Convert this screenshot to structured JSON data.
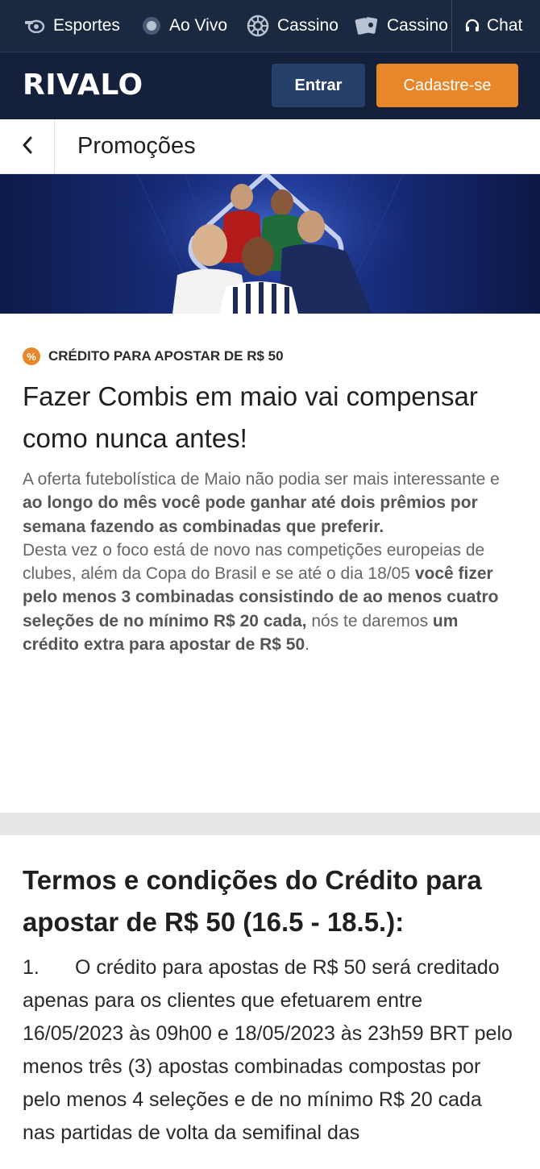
{
  "nav": {
    "items": [
      {
        "label": "Esportes",
        "icon": "whistle-icon"
      },
      {
        "label": "Ao Vivo",
        "icon": "live-dot-icon"
      },
      {
        "label": "Cassino",
        "icon": "roulette-icon"
      },
      {
        "label": "Cassino",
        "icon": "cards-icon"
      }
    ],
    "chat_label": "Chat"
  },
  "header": {
    "logo": "RIVALO",
    "login_label": "Entrar",
    "signup_label": "Cadastre-se"
  },
  "titlebar": {
    "title": "Promoções"
  },
  "promo": {
    "badge": "CRÉDITO PARA APOSTAR DE R$ 50",
    "headline": "Fazer Combis em maio vai compensar como nunca antes!",
    "p1_a": "A oferta futebolística de Maio não podia ser mais interessante e ",
    "p1_b": "ao longo do mês você pode ganhar até dois prêmios por semana fazendo as combinadas que preferir.",
    "p2_a": "Desta vez o foco está de novo nas competições europeias de clubes, além da Copa do Brasil e se até o dia 18/05 ",
    "p2_b": "você fizer pelo menos 3 combinadas consistindo de ao menos cuatro seleções de no mínimo R$ 20 cada,",
    "p2_c": " nós te daremos ",
    "p2_d": "um crédito extra para apostar de R$ 50",
    "p2_e": "."
  },
  "terms": {
    "title": "Termos e condições do Crédito para apostar de R$ 50 (16.5 - 18.5.):",
    "item1_number": "1.",
    "item1_text": "O crédito para apostas de R$ 50 será creditado apenas para os clientes que efetuarem entre 16/05/2023 às 09h00 e 18/05/2023 às 23h59 BRT pelo menos três (3) apostas combinadas compostas por pelo menos 4 seleções e de no mínimo R$ 20 cada nas partidas de volta da semifinal das"
  },
  "colors": {
    "nav_bg": "#1b2940",
    "header_bg": "#15213a",
    "login_bg": "#26406a",
    "signup_bg": "#e8862a",
    "accent": "#e8862a"
  }
}
